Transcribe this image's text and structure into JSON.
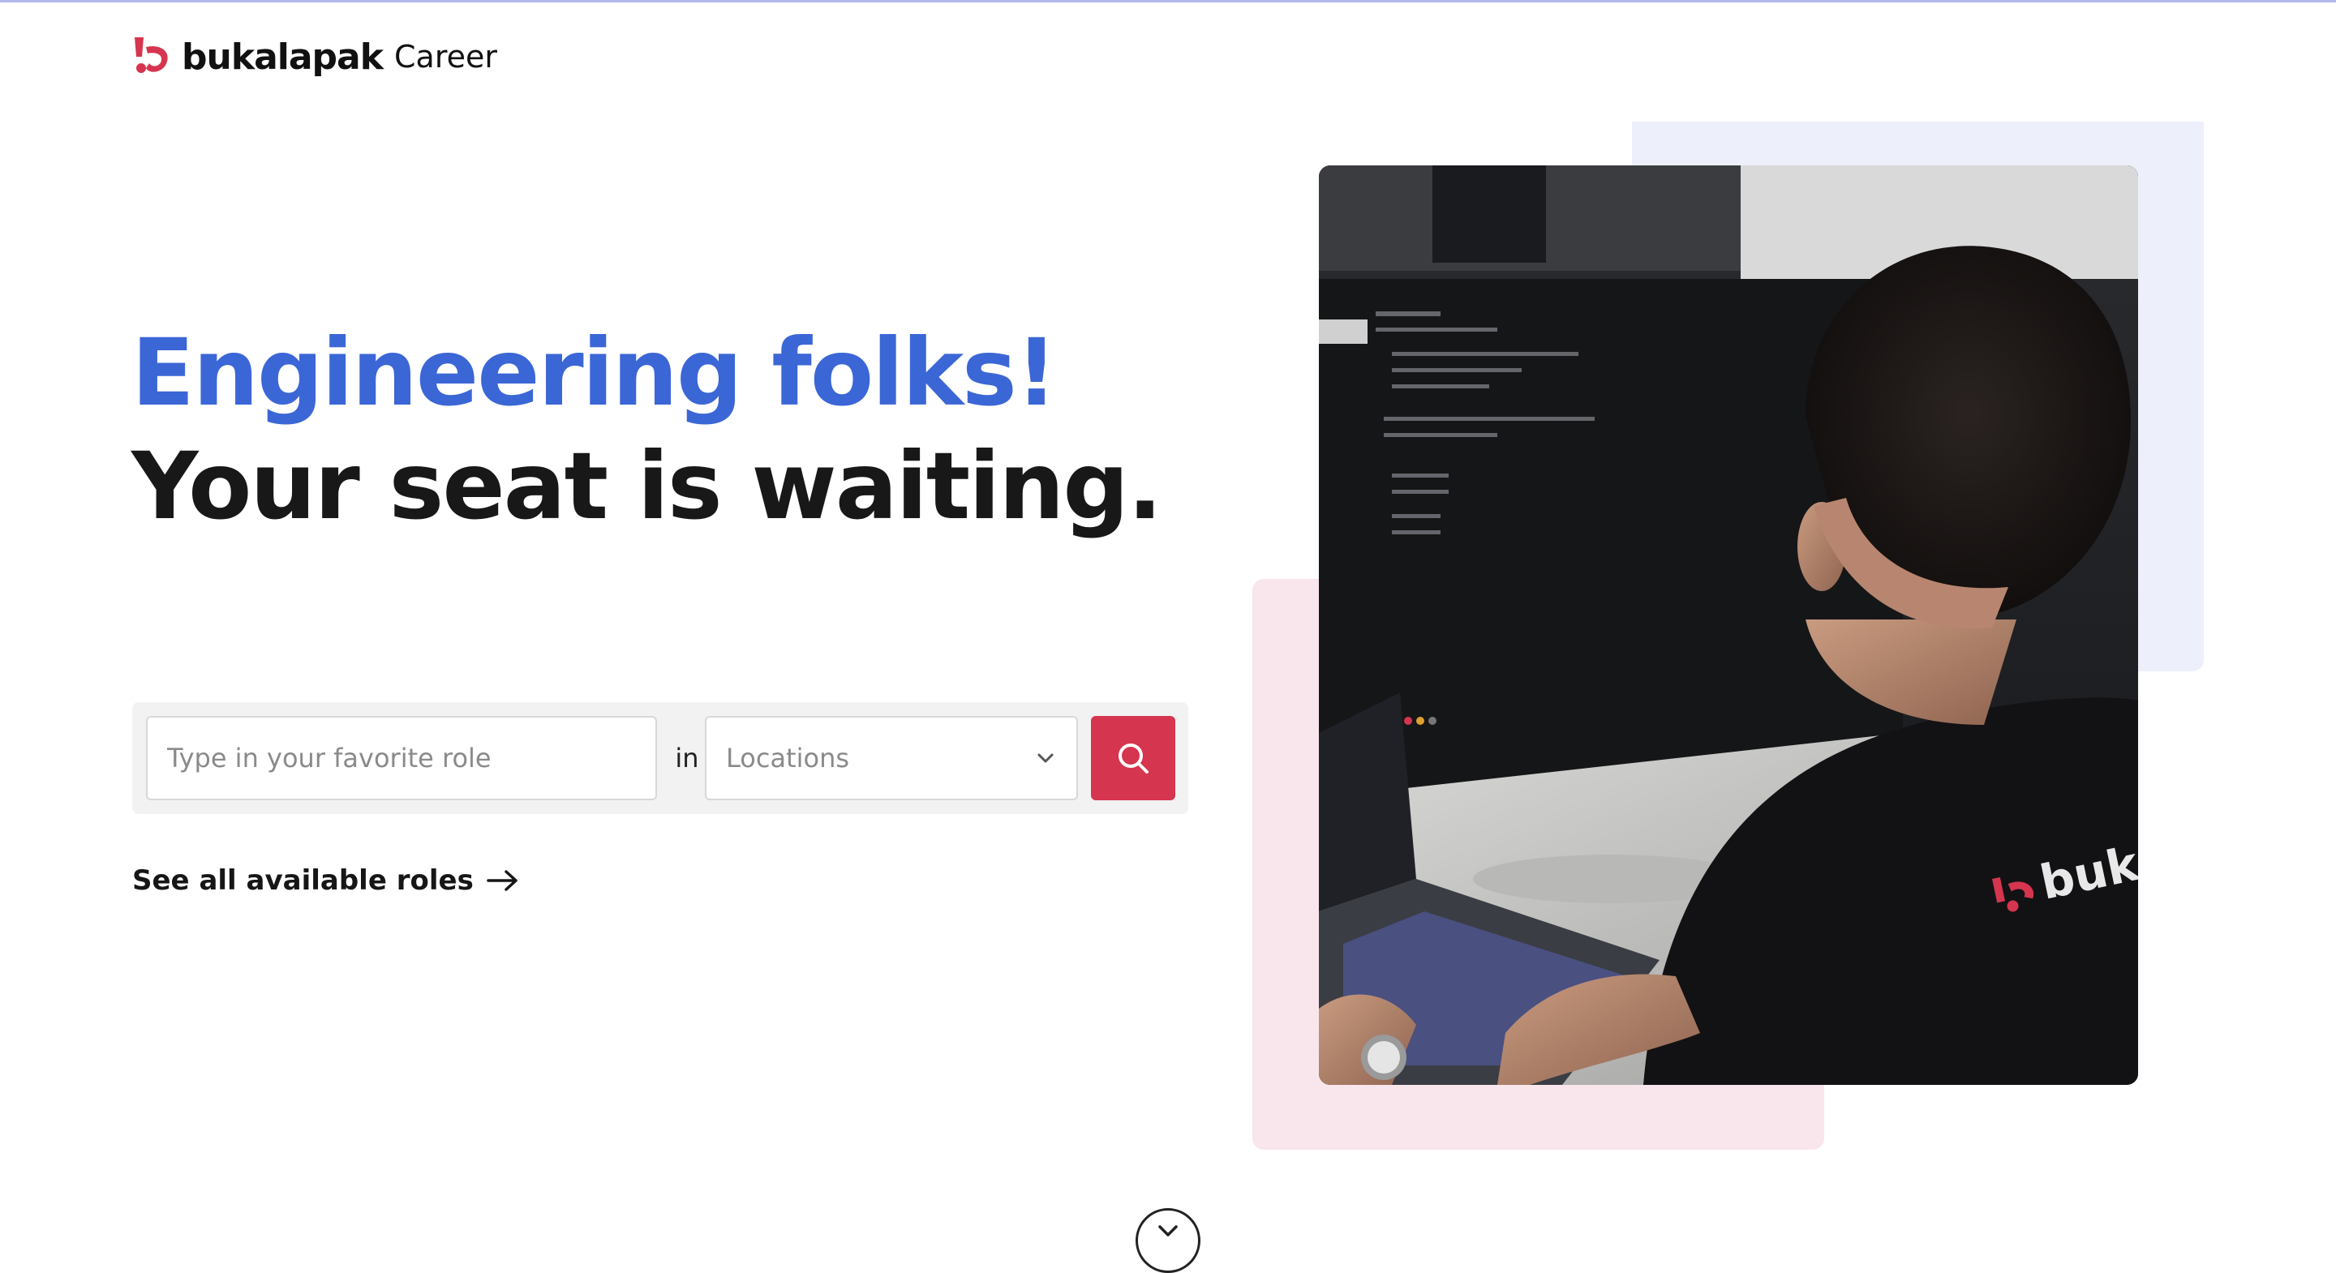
{
  "header": {
    "brand": "bukalapak",
    "section": "Career",
    "logo_icon": "bukalapak-logo-icon",
    "brand_color": "#d6354f"
  },
  "hero": {
    "headline_line1": "Engineering folks!",
    "headline_line2": "Your seat is waiting.",
    "headline_accent_color": "#3b66d6"
  },
  "search": {
    "role_placeholder": "Type in your favorite role",
    "role_value": "",
    "connector": "in",
    "location_placeholder": "Locations",
    "location_icon": "chevron-down-icon",
    "button_icon": "search-icon",
    "button_color": "#d6354f"
  },
  "links": {
    "see_all_roles": "See all available roles",
    "see_all_icon": "arrow-right-icon"
  },
  "visual": {
    "photo_alt": "engineer-working-at-computer-photo",
    "shirt_logo_text": "buk",
    "blue_accent": "#edf0fa",
    "pink_accent": "#f8e6ec"
  },
  "scroll": {
    "icon": "chevron-down-circle-icon"
  }
}
